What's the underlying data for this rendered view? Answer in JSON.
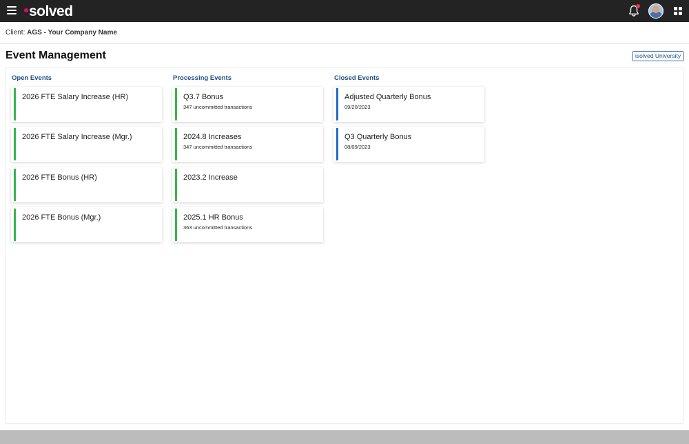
{
  "brand": {
    "name": "solved"
  },
  "client": {
    "label": "Client:",
    "name": "AGS - Your Company Name"
  },
  "page": {
    "title": "Event Management",
    "university_button": "isolved University"
  },
  "columns": {
    "open": {
      "header": "Open Events",
      "cards": [
        {
          "title": "2026 FTE Salary Increase (HR)",
          "sub": ""
        },
        {
          "title": "2026 FTE Salary Increase (Mgr.)",
          "sub": ""
        },
        {
          "title": "2026 FTE Bonus (HR)",
          "sub": ""
        },
        {
          "title": "2026 FTE Bonus (Mgr.)",
          "sub": ""
        }
      ]
    },
    "processing": {
      "header": "Processing Events",
      "cards": [
        {
          "title": "Q3.7 Bonus",
          "sub": "347 uncommitted transactions"
        },
        {
          "title": "2024.8 Increases",
          "sub": "347 uncommitted transactions"
        },
        {
          "title": "2023.2 Increase",
          "sub": ""
        },
        {
          "title": "2025.1 HR Bonus",
          "sub": "363 uncommitted transactions"
        }
      ]
    },
    "closed": {
      "header": "Closed Events",
      "cards": [
        {
          "title": "Adjusted Quarterly Bonus",
          "sub": "09/20/2023"
        },
        {
          "title": "Q3 Quarterly Bonus",
          "sub": "08/09/2023"
        }
      ]
    }
  },
  "colors": {
    "topbar": "#232323",
    "brand_dot": "#e6007e",
    "open_accent": "#37b64a",
    "processing_accent": "#37b64a",
    "closed_accent": "#1e6cc7",
    "header_blue": "#1d4f86"
  },
  "icons": [
    "hamburger-menu-icon",
    "bell-icon",
    "user-avatar",
    "apps-grid-icon"
  ]
}
